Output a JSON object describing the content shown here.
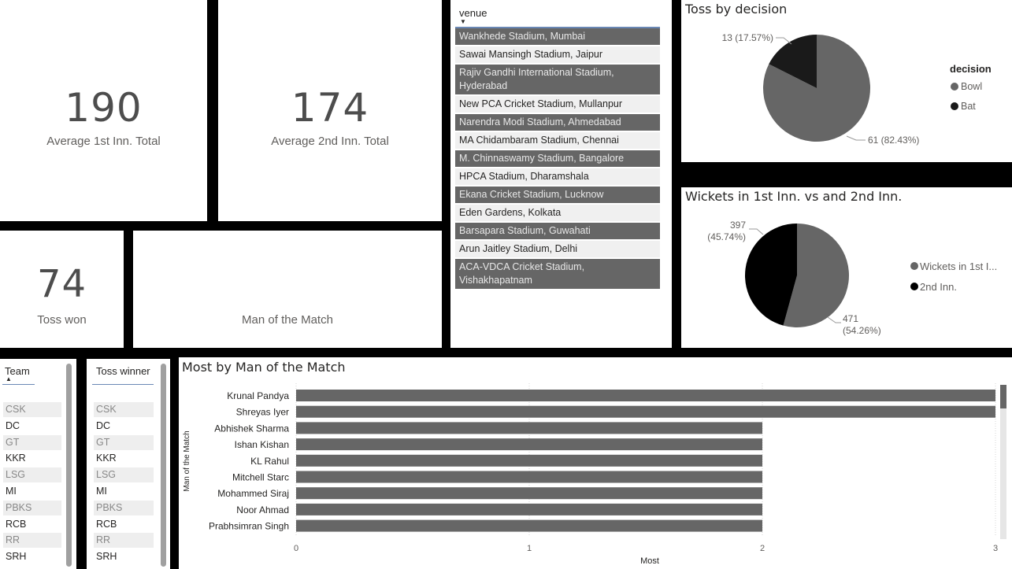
{
  "kpis": {
    "avg_first": {
      "value": "190",
      "label": "Average 1st Inn. Total"
    },
    "avg_second": {
      "value": "174",
      "label": "Average 2nd Inn. Total"
    },
    "toss_won": {
      "value": "74",
      "label": "Toss won"
    },
    "motm": {
      "label": "Man of the Match"
    }
  },
  "venue_slicer": {
    "title": "venue",
    "items": [
      {
        "label": "Wankhede Stadium, Mumbai",
        "selected": true
      },
      {
        "label": "Sawai Mansingh Stadium, Jaipur",
        "selected": false
      },
      {
        "label": "Rajiv Gandhi International Stadium, Hyderabad",
        "selected": true
      },
      {
        "label": "New PCA Cricket Stadium, Mullanpur",
        "selected": false
      },
      {
        "label": "Narendra Modi Stadium, Ahmedabad",
        "selected": true
      },
      {
        "label": "MA Chidambaram Stadium, Chennai",
        "selected": false
      },
      {
        "label": "M. Chinnaswamy Stadium, Bangalore",
        "selected": true
      },
      {
        "label": "HPCA Stadium, Dharamshala",
        "selected": false
      },
      {
        "label": "Ekana Cricket Stadium, Lucknow",
        "selected": true
      },
      {
        "label": "Eden Gardens, Kolkata",
        "selected": false
      },
      {
        "label": "Barsapara Stadium, Guwahati",
        "selected": true
      },
      {
        "label": "Arun Jaitley Stadium, Delhi",
        "selected": false
      },
      {
        "label": "ACA-VDCA Cricket Stadium, Vishakhapatnam",
        "selected": true
      }
    ]
  },
  "team_slicer": {
    "title": "Team",
    "items": [
      "CSK",
      "DC",
      "GT",
      "KKR",
      "LSG",
      "MI",
      "PBKS",
      "RCB",
      "RR",
      "SRH"
    ]
  },
  "toss_winner_slicer": {
    "title": "Toss winner",
    "items": [
      "CSK",
      "DC",
      "GT",
      "KKR",
      "LSG",
      "MI",
      "PBKS",
      "RCB",
      "RR",
      "SRH"
    ]
  },
  "chart_data": [
    {
      "type": "pie",
      "title": "Toss by decision",
      "legend_title": "decision",
      "legend_position": "right",
      "slices": [
        {
          "name": "Bowl",
          "value": 61,
          "label": "61 (82.43%)",
          "color": "#666666"
        },
        {
          "name": "Bat",
          "value": 13,
          "label": "13 (17.57%)",
          "color": "#1a1a1a"
        }
      ]
    },
    {
      "type": "pie",
      "title": "Wickets in 1st Inn. vs and 2nd Inn.",
      "legend_position": "right",
      "slices": [
        {
          "name": "Wickets in 1st I...",
          "value": 471,
          "label_lines": [
            "471",
            "(54.26%)"
          ],
          "color": "#666666"
        },
        {
          "name": "2nd Inn.",
          "value": 397,
          "label_lines": [
            "397",
            "(45.74%)"
          ],
          "color": "#000000"
        }
      ]
    },
    {
      "type": "bar",
      "orientation": "horizontal",
      "title": "Most by Man of the Match",
      "xlabel": "Most",
      "ylabel": "Man of the Match",
      "xlim": [
        0,
        3
      ],
      "xticks": [
        "0",
        "1",
        "2",
        "3"
      ],
      "categories": [
        "Krunal Pandya",
        "Shreyas Iyer",
        "Abhishek Sharma",
        "Ishan Kishan",
        "KL Rahul",
        "Mitchell Starc",
        "Mohammed Siraj",
        "Noor Ahmad",
        "Prabhsimran Singh"
      ],
      "values": [
        3,
        3,
        2,
        2,
        2,
        2,
        2,
        2,
        2
      ],
      "color": "#666666",
      "grid": true
    }
  ]
}
